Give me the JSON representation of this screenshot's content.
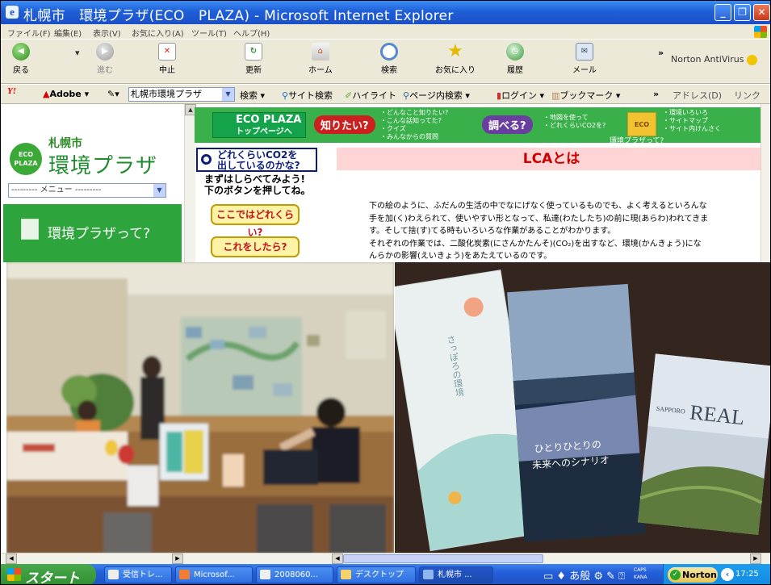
{
  "window": {
    "title": "札幌市　環境プラザ(ECO　PLAZA) - Microsoft Internet Explorer"
  },
  "menubar": [
    "ファイル(F)",
    "編集(E)",
    "表示(V)",
    "お気に入り(A)",
    "ツール(T)",
    "ヘルプ(H)"
  ],
  "toolbar": {
    "back": "戻る",
    "forward": "進む",
    "stop": "中止",
    "refresh": "更新",
    "home": "ホーム",
    "search": "検索",
    "favorites": "お気に入り",
    "history": "履歴",
    "mail": "メール",
    "norton": "Norton AntiVirus"
  },
  "linkbar": {
    "yahoo": "Y!",
    "adobe": "Adobe",
    "search_box_value": "札幌市環境プラザ",
    "search_btn": "検索",
    "site_search": "サイト検索",
    "highlight": "ハイライト",
    "page_search": "ページ内検索",
    "login": "ログイン",
    "bookmark": "ブックマーク",
    "address": "アドレス(D)",
    "links": "リンク"
  },
  "site": {
    "logo_badge": "ECO PLAZA",
    "logo_city": "札幌市",
    "logo_name": "環境プラザ",
    "menu_select": "--------- メニュー ---------",
    "nav_about": "環境プラザって?",
    "banner": {
      "top_title": "ECO PLAZA",
      "top_sub": "トップページへ",
      "know": "知りたい?",
      "know_list": [
        "・どんなこと知りたい?",
        "・こんな話知ってた?",
        "・クイズ",
        "・みんなからの質問"
      ],
      "check": "調べる?",
      "check_list": [
        "・地図を使って",
        "・どれくらいCO2を?"
      ],
      "eco_q": "環境プラザって?",
      "eco_list": [
        "・環境いろいろ",
        "・サイトマップ",
        "・サイト内けんさく"
      ]
    },
    "co2_box": [
      "どれくらいCO2を",
      "出しているのかな?"
    ],
    "co2_sub": [
      "まずはしらべてみよう!",
      "下のボタンを押してね。"
    ],
    "btn_how_much": "ここではどれくらい?",
    "btn_if": "これをしたら?",
    "lca_title": "LCAとは",
    "lca_text": [
      "下の絵のように、ふだんの生活の中でなにげなく使っているものでも、よく考えるといろんな",
      "手を加(く)わえられて、使いやすい形となって、私達(わたしたち)の前に現(あらわ)われてきま",
      "す。そして捨(す)てる時もいろいろな作業があることがわかります。",
      "それぞれの作業では、二酸化炭素(にさんかたんそ)(CO₂)を出すなど、環境(かんきょう)にな",
      "んらかの影響(えいきょう)をあたえているのです。"
    ]
  },
  "photo_right": {
    "book1": "さっぽろの環境",
    "book2_line1": "ひとりひとりの",
    "book2_line2": "未来へのシナリオ",
    "book3_small": "SAPPORO",
    "book3_big": "REAL"
  },
  "taskbar": {
    "start": "スタート",
    "tasks": [
      "受信トレ...",
      "Microsof...",
      "2008060...",
      "デスクトップ",
      "札幌市 ..."
    ],
    "tray_ime": "あ般",
    "tray_caps": "CAPS KANA",
    "norton": "Norton",
    "clock": "17:25"
  }
}
